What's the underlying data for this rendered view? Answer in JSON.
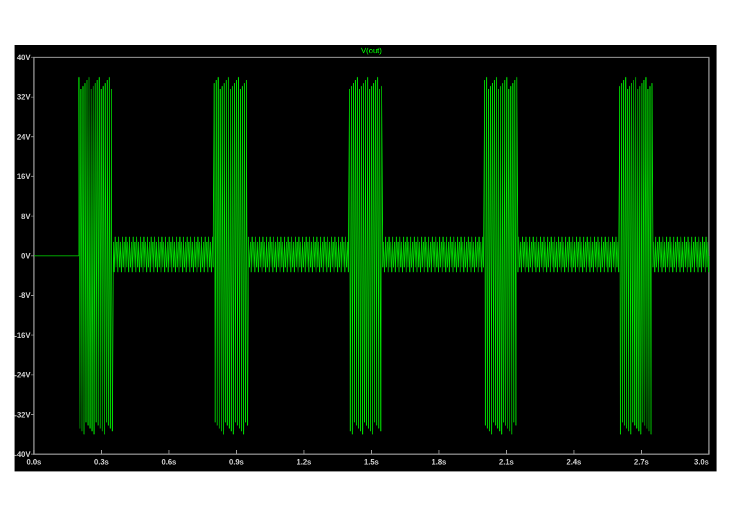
{
  "plot": {
    "trace_label": "V(out)",
    "y_ticks": [
      "40V",
      "32V",
      "24V",
      "16V",
      "8V",
      "0V",
      "-8V",
      "-16V",
      "-24V",
      "-32V",
      "-40V"
    ],
    "x_ticks": [
      "0.0s",
      "0.3s",
      "0.6s",
      "0.9s",
      "1.2s",
      "1.5s",
      "1.8s",
      "2.1s",
      "2.4s",
      "2.7s",
      "3.0s"
    ]
  }
}
